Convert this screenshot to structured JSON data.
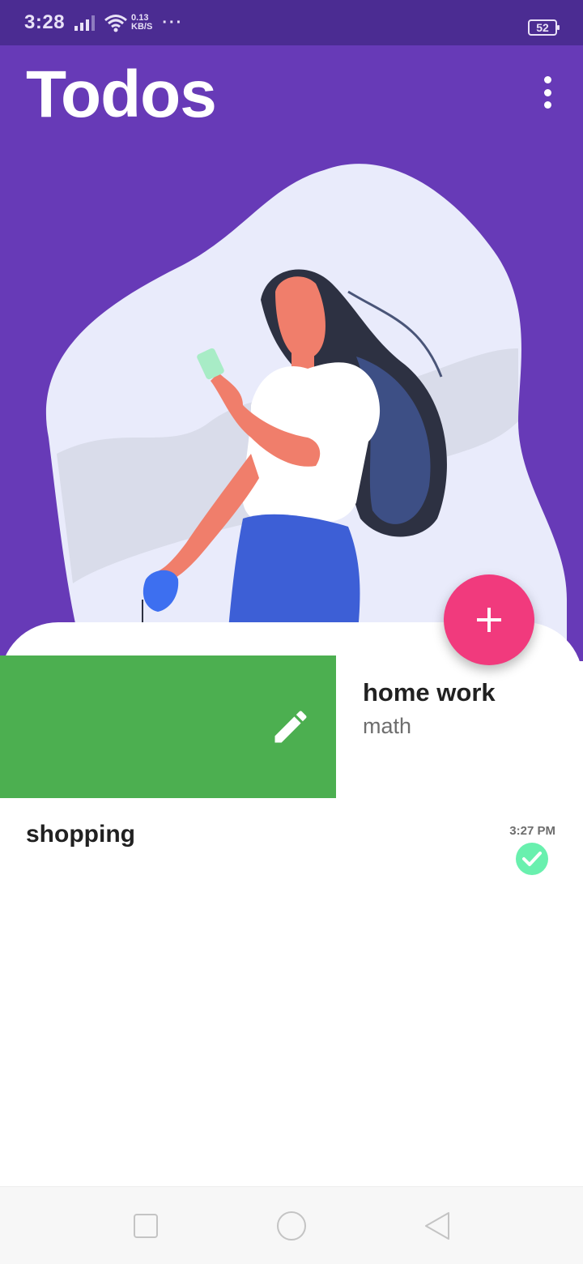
{
  "status_bar": {
    "time": "3:28",
    "net_speed_value": "0.13",
    "net_speed_unit": "KB/S",
    "more": "···",
    "battery": "52"
  },
  "app": {
    "title": "Todos"
  },
  "todos": [
    {
      "title": "home work",
      "description": "math"
    },
    {
      "title": "shopping",
      "time": "3:27 PM",
      "status": "completed"
    }
  ],
  "colors": {
    "status_bar": "#4b2c92",
    "header": "#673ab7",
    "edit_action": "#4caf50",
    "fab": "#f13a7d",
    "check": "#69f0ae"
  },
  "icons": [
    "signal-icon",
    "wifi-icon",
    "battery-icon",
    "overflow-menu-icon",
    "edit-icon",
    "plus-icon",
    "check-icon"
  ]
}
